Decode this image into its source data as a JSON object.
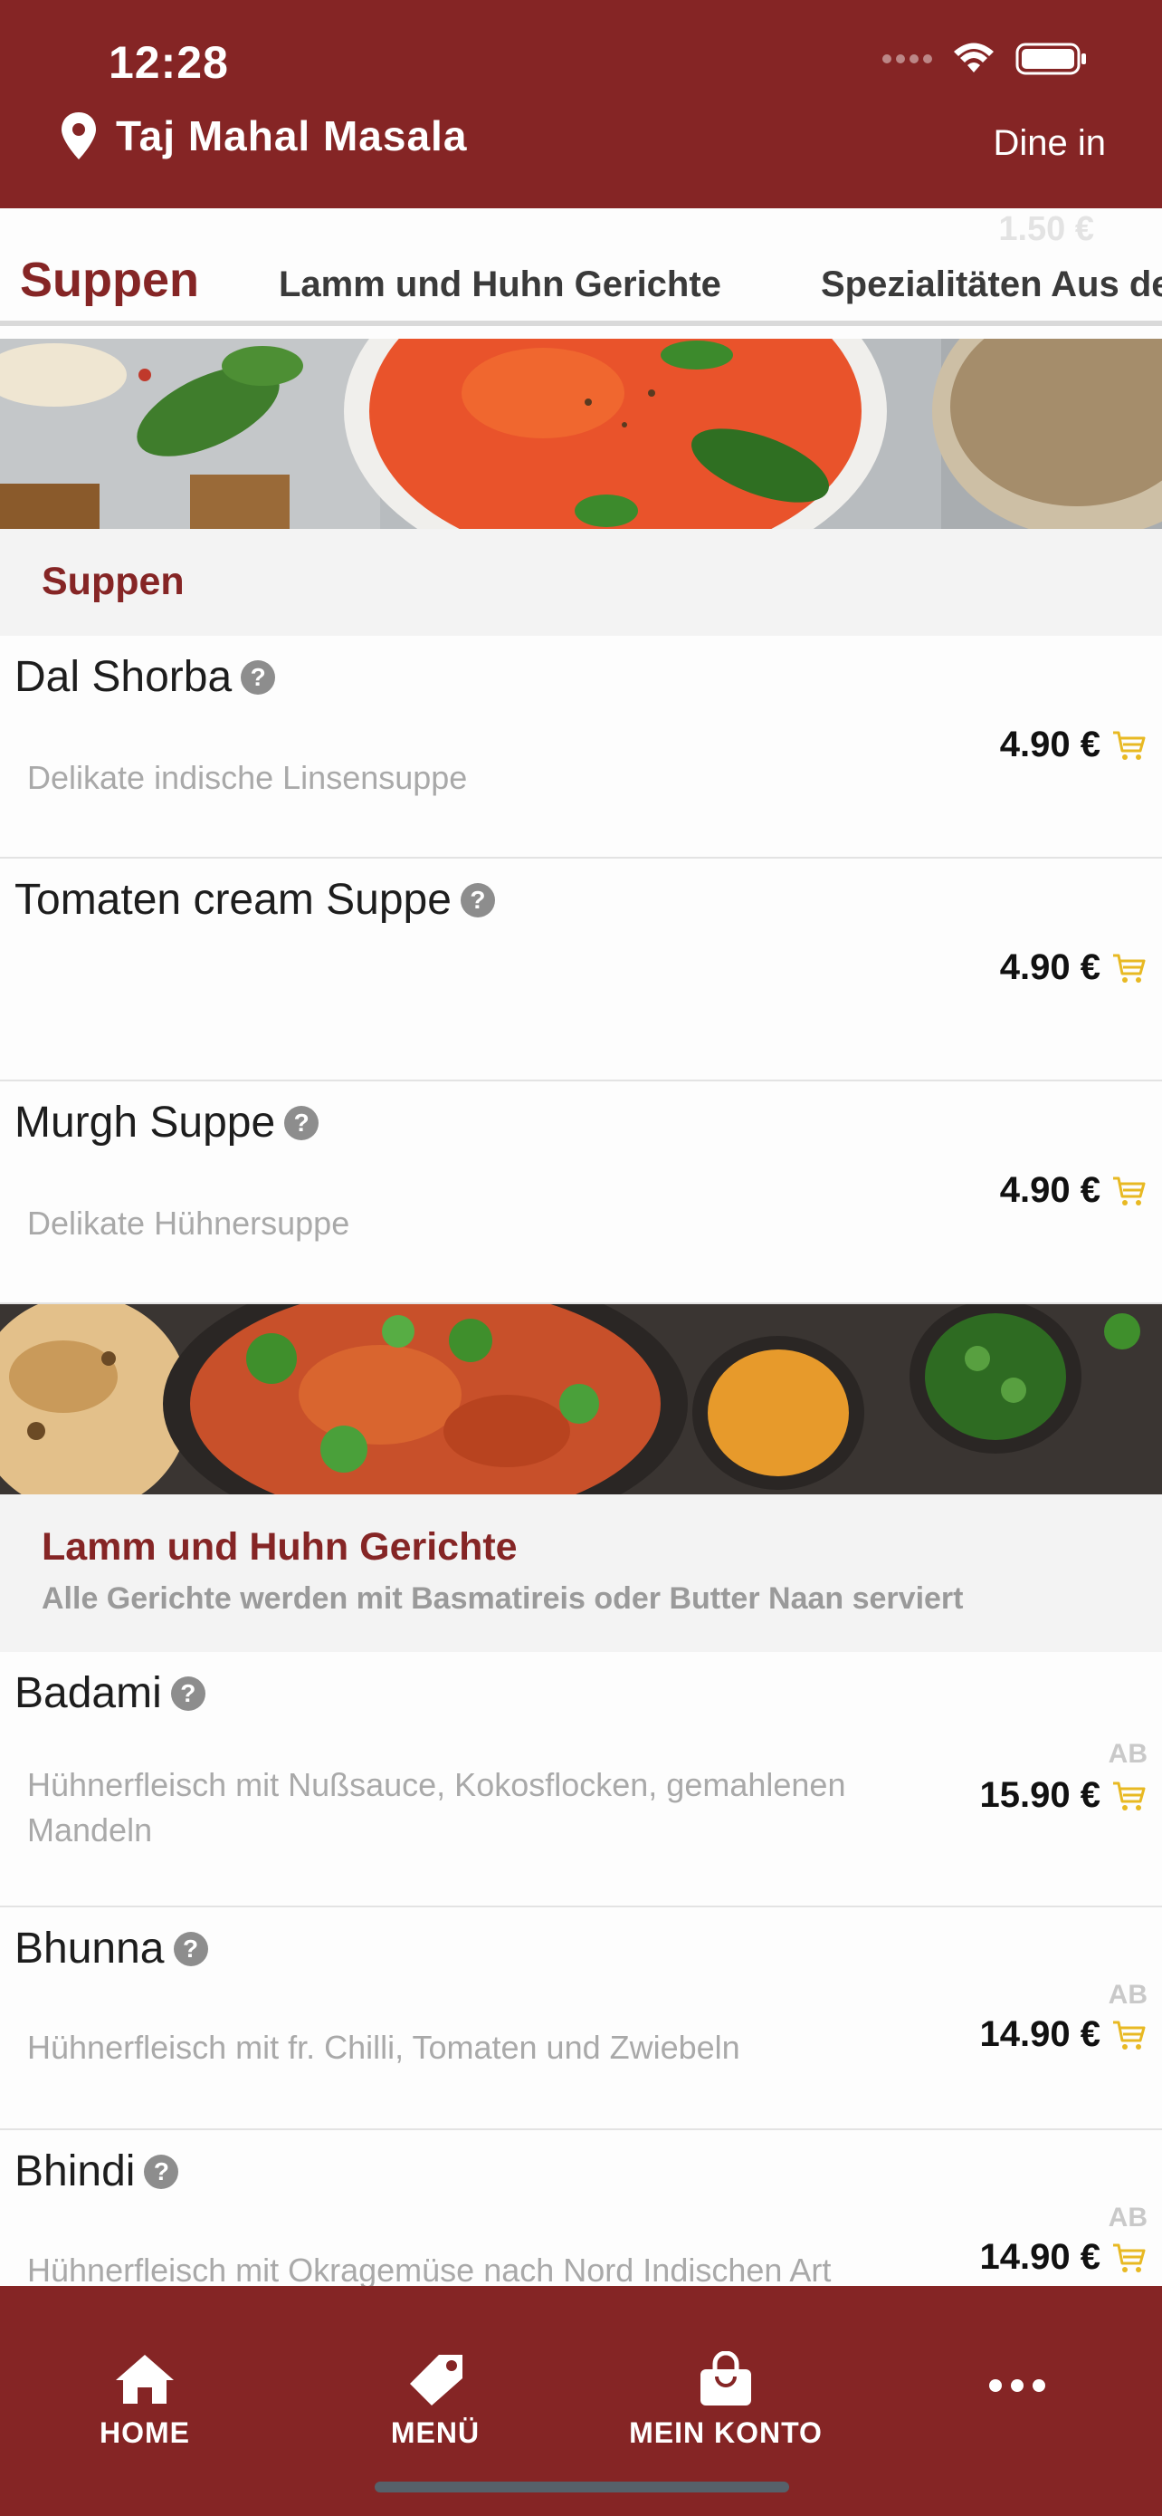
{
  "status_bar": {
    "time": "12:28"
  },
  "header": {
    "restaurant_name": "Taj Mahal Masala",
    "order_mode": "Dine in"
  },
  "tabs": {
    "ghost_price": "1.50 €",
    "items": [
      {
        "label": "Suppen"
      },
      {
        "label": "Lamm und Huhn Gerichte"
      },
      {
        "label": "Spezialitäten Aus de"
      }
    ]
  },
  "sections": [
    {
      "title": "Suppen",
      "items": [
        {
          "name": "Dal Shorba",
          "description": "Delikate indische Linsensuppe",
          "price": "4.90 €"
        },
        {
          "name": "Tomaten cream Suppe",
          "description": "",
          "price": "4.90 €"
        },
        {
          "name": "Murgh Suppe",
          "description": "Delikate Hühnersuppe",
          "price": "4.90 €"
        }
      ]
    },
    {
      "title": "Lamm und Huhn Gerichte",
      "subtitle": "Alle Gerichte werden mit Basmatireis oder Butter Naan serviert",
      "items": [
        {
          "name": "Badami",
          "description": "Hühnerfleisch mit Nußsauce, Kokosflocken, gemahlenen Mandeln",
          "price": "15.90 €",
          "price_prefix": "AB"
        },
        {
          "name": "Bhunna",
          "description": "Hühnerfleisch mit fr. Chilli, Tomaten und Zwiebeln",
          "price": "14.90 €",
          "price_prefix": "AB"
        },
        {
          "name": "Bhindi",
          "description": "Hühnerfleisch mit Okragemüse nach Nord Indischen Art",
          "price": "14.90 €",
          "price_prefix": "AB"
        }
      ]
    }
  ],
  "bottom_nav": [
    {
      "label": "HOME",
      "icon": "home-icon"
    },
    {
      "label": "MENÜ",
      "icon": "tag-icon"
    },
    {
      "label": "MEIN KONTO",
      "icon": "shopping-bag-icon"
    },
    {
      "label": "",
      "icon": "more-icon"
    }
  ],
  "colors": {
    "brand": "#852525",
    "cart": "#e8b923",
    "muted_text": "#a9a9a9"
  }
}
